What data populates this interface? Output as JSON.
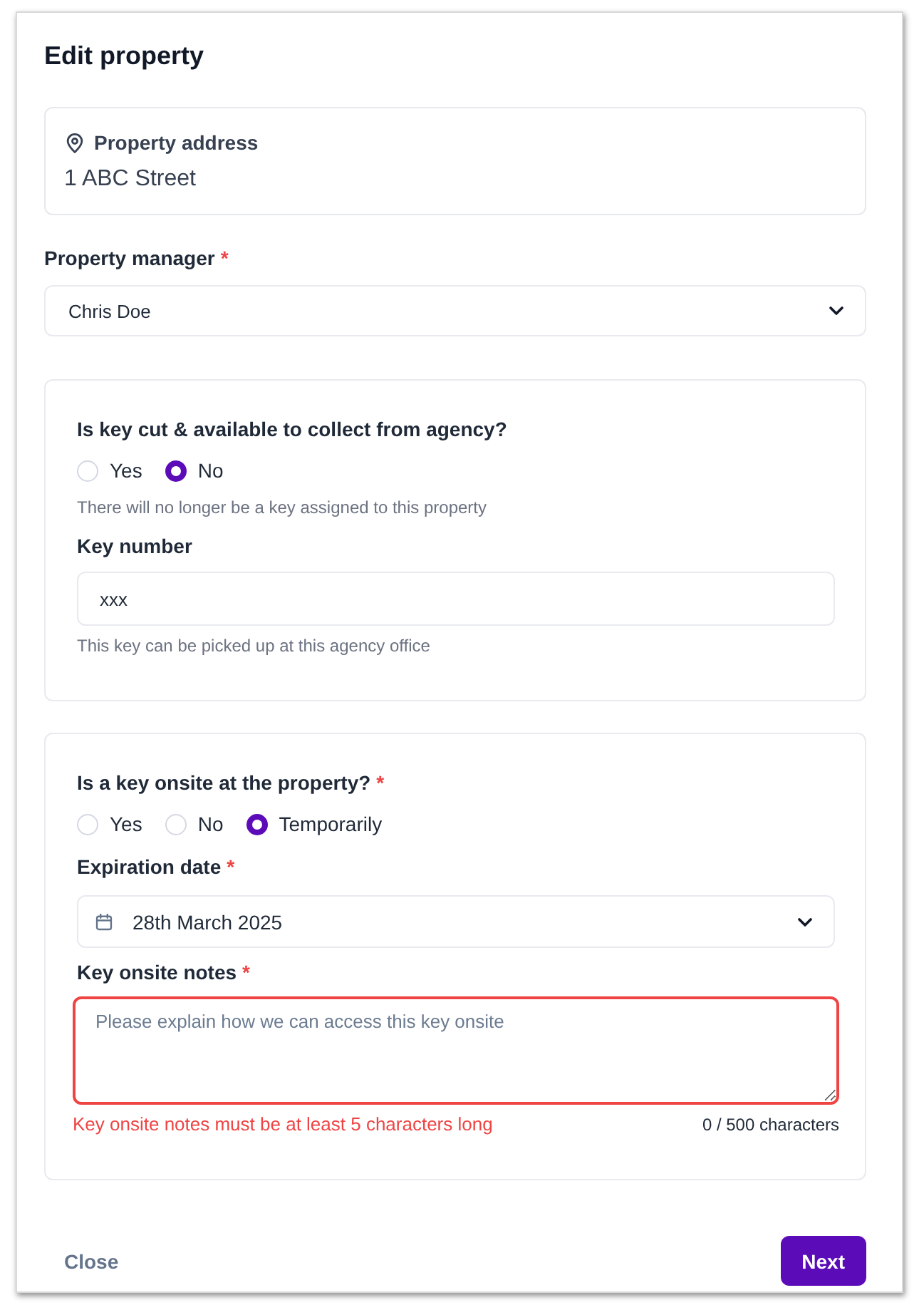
{
  "dialog": {
    "title": "Edit property"
  },
  "address_card": {
    "label": "Property address",
    "value": "1 ABC Street"
  },
  "property_manager": {
    "label": "Property manager",
    "required_mark": "*",
    "value": "Chris Doe"
  },
  "sections": [
    {
      "fields": [
        {
          "kind": "radio",
          "label": "Is key cut & available to collect from agency?",
          "options": [
            {
              "label": "Yes",
              "selected": false
            },
            {
              "label": "No",
              "selected": true
            }
          ],
          "helper": "There will no longer be a key assigned to this property"
        },
        {
          "kind": "text",
          "label": "Key number",
          "value": "xxx",
          "helper": "This key can be picked up at this agency office"
        }
      ]
    },
    {
      "fields": [
        {
          "kind": "radio",
          "label": "Is a key onsite at the property?",
          "required_mark": "*",
          "options": [
            {
              "label": "Yes",
              "selected": false
            },
            {
              "label": "No",
              "selected": false
            },
            {
              "label": "Temporarily",
              "selected": true
            }
          ]
        },
        {
          "kind": "date",
          "label": "Expiration date",
          "required_mark": "*",
          "value": "28th March 2025"
        },
        {
          "kind": "textarea",
          "label": "Key onsite notes",
          "required_mark": "*",
          "placeholder": "Please explain how we can access this key onsite",
          "invalid": true,
          "error": "Key onsite notes must be at least 5 characters long",
          "counter": "0 / 500 characters"
        }
      ]
    }
  ],
  "footer": {
    "buttons": [
      {
        "label": "Close",
        "kind": "secondary"
      },
      {
        "label": "Next",
        "kind": "primary"
      }
    ]
  }
}
